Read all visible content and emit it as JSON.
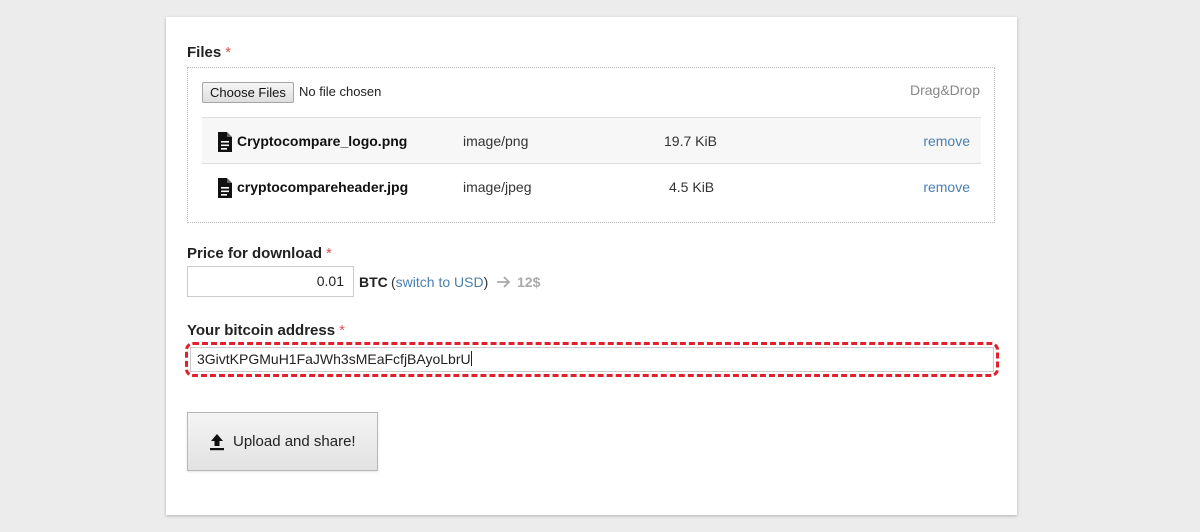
{
  "files": {
    "label": "Files",
    "required_mark": "*",
    "choose_button": "Choose Files",
    "no_file_text": "No file chosen",
    "drag_drop": "Drag&Drop",
    "items": [
      {
        "name": "Cryptocompare_logo.png",
        "type": "image/png",
        "size": "19.7 KiB",
        "action": "remove",
        "icon": "file-icon"
      },
      {
        "name": "cryptocompareheader.jpg",
        "type": "image/jpeg",
        "size": "4.5 KiB",
        "action": "remove",
        "icon": "file-icon"
      }
    ]
  },
  "price": {
    "label": "Price for download",
    "required_mark": "*",
    "value": "0.01",
    "currency": "BTC",
    "switch_open": "(",
    "switch_link": "switch to USD",
    "switch_close": ")",
    "converted": "12$",
    "arrow_icon": "arrow-right-icon"
  },
  "address": {
    "label": "Your bitcoin address",
    "required_mark": "*",
    "value": "3GivtKPGMuH1FaJWh3sMEaFcfjBAyoLbrU",
    "highlight_color": "#e0212b"
  },
  "upload": {
    "label": "Upload and share!",
    "icon": "upload-icon"
  },
  "colors": {
    "link": "#4a7fb0",
    "required": "#d9534f",
    "background": "#ececec"
  }
}
